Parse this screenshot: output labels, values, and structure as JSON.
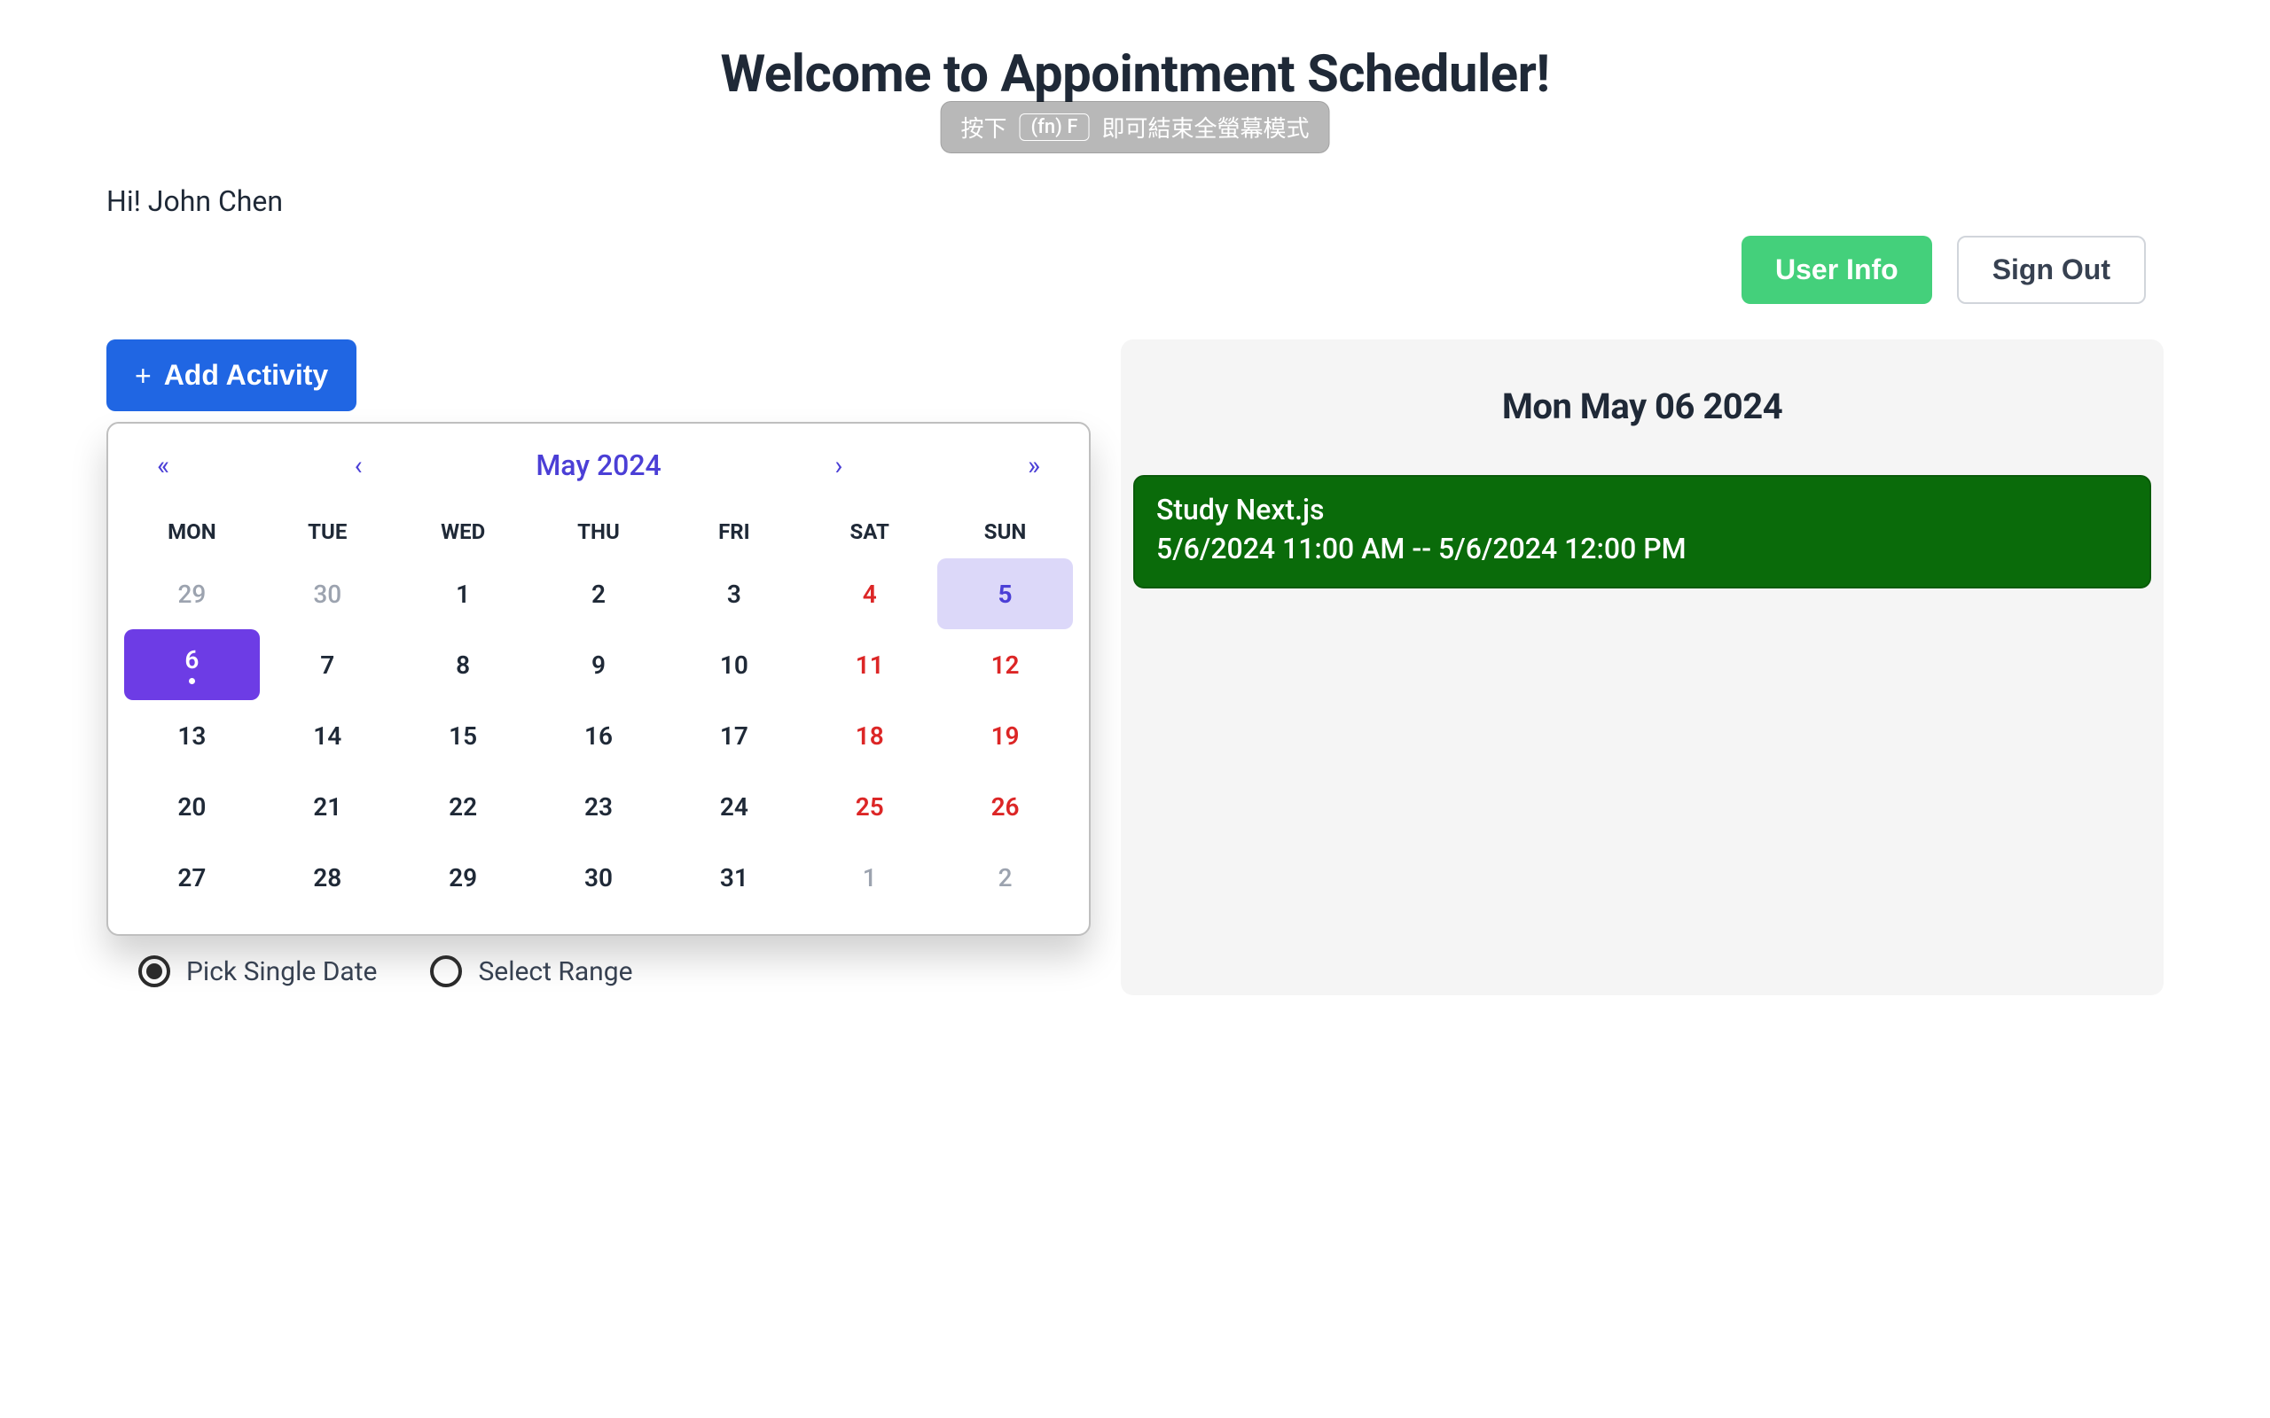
{
  "title": "Welcome to Appointment Scheduler!",
  "greeting": "Hi! John Chen",
  "actions": {
    "user_info": "User Info",
    "sign_out": "Sign Out"
  },
  "add_activity_label": "Add Activity",
  "calendar": {
    "month_label": "May 2024",
    "nav": {
      "prev_year": "«",
      "prev_month": "‹",
      "next_month": "›",
      "next_year": "»"
    },
    "weekdays": [
      "MON",
      "TUE",
      "WED",
      "THU",
      "FRI",
      "SAT",
      "SUN"
    ],
    "cells": [
      {
        "n": "29",
        "other": true
      },
      {
        "n": "30",
        "other": true
      },
      {
        "n": "1"
      },
      {
        "n": "2"
      },
      {
        "n": "3"
      },
      {
        "n": "4",
        "weekend": true
      },
      {
        "n": "5",
        "today": true
      },
      {
        "n": "6",
        "selected": true,
        "has_event": true
      },
      {
        "n": "7"
      },
      {
        "n": "8"
      },
      {
        "n": "9"
      },
      {
        "n": "10"
      },
      {
        "n": "11",
        "weekend": true
      },
      {
        "n": "12",
        "weekend": true
      },
      {
        "n": "13"
      },
      {
        "n": "14"
      },
      {
        "n": "15"
      },
      {
        "n": "16"
      },
      {
        "n": "17"
      },
      {
        "n": "18",
        "weekend": true
      },
      {
        "n": "19",
        "weekend": true
      },
      {
        "n": "20"
      },
      {
        "n": "21"
      },
      {
        "n": "22"
      },
      {
        "n": "23"
      },
      {
        "n": "24"
      },
      {
        "n": "25",
        "weekend": true
      },
      {
        "n": "26",
        "weekend": true
      },
      {
        "n": "27"
      },
      {
        "n": "28"
      },
      {
        "n": "29"
      },
      {
        "n": "30"
      },
      {
        "n": "31"
      },
      {
        "n": "1",
        "other": true
      },
      {
        "n": "2",
        "other": true
      }
    ]
  },
  "mode": {
    "single_label": "Pick Single Date",
    "range_label": "Select Range",
    "selected": "single"
  },
  "panel": {
    "date_label": "Mon May 06 2024",
    "events": [
      {
        "title": "Study Next.js",
        "time": "5/6/2024 11:00 AM -- 5/6/2024 12:00 PM"
      }
    ]
  },
  "overlay": {
    "prefix": "按下",
    "key": "(fn) F",
    "suffix": "即可結束全螢幕模式"
  }
}
